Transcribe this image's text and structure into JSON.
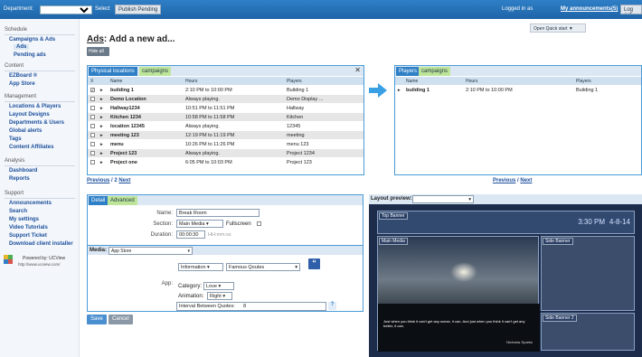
{
  "topbar": {
    "department_label": "Department:",
    "select_label": "Select",
    "publish_label": "Publish Pending",
    "logged_in": "Logged in as",
    "announcements": "My announcements(5)",
    "logout": "Log out"
  },
  "sidebar": {
    "schedule": "Schedule",
    "campaigns_ads": "Campaigns & Ads",
    "ads": "Ads",
    "pending_ads": "Pending ads",
    "content": "Content",
    "ezboard": "EZBoard ®",
    "app_store": "App Store",
    "management": "Management",
    "locations_players": "Locations & Players",
    "layout_designs": "Layout Designs",
    "departments_users": "Departments & Users",
    "global_alerts": "Global alerts",
    "tags": "Tags",
    "content_affiliates": "Content Affiliates",
    "analysis": "Analysis",
    "dashboard": "Dashboard",
    "reports": "Reports",
    "support": "Support",
    "announcements": "Announcements",
    "search": "Search",
    "my_settings": "My settings",
    "video_tutorials": "Video Tutorials",
    "support_ticket": "Support Ticket",
    "download_installer": "Download client installer",
    "powered_by": "Powered by: UCView",
    "powered_url": "http://www.ucview.com/"
  },
  "main": {
    "title_prefix": "Ads",
    "title_rest": ": Add a new ad...",
    "hide_all": "Hide all",
    "quick_start": "Open Quick start ▼"
  },
  "locations": {
    "tab_physical": "Physical locations",
    "tab_campaigns": "campaigns",
    "close": "✕",
    "col_x": "X",
    "col_name": "Name",
    "col_hours": "Hours",
    "col_players": "Players",
    "rows": [
      {
        "name": "building 1",
        "hours": "2:10 PM to 10:00 PM",
        "players": "Building 1",
        "checked": "✓"
      },
      {
        "name": "Demo Location",
        "hours": "Always playing.",
        "players": "Demo Display ...",
        "checked": ""
      },
      {
        "name": "Hallway1234",
        "hours": "10:51 PM to 11:51 PM",
        "players": "Hallway",
        "checked": ""
      },
      {
        "name": "Kitchen 1234",
        "hours": "10:58 PM to 11:58 PM",
        "players": "Kitchen",
        "checked": ""
      },
      {
        "name": "location 12345",
        "hours": "Always playing.",
        "players": "12345",
        "checked": ""
      },
      {
        "name": "meeting 123",
        "hours": "12:19 PM to 11:19 PM",
        "players": "meeting",
        "checked": ""
      },
      {
        "name": "menu",
        "hours": "10:26 PM to 11:26 PM",
        "players": "menu 123",
        "checked": ""
      },
      {
        "name": "Project 123",
        "hours": "Always playing.",
        "players": "Project 1234",
        "checked": ""
      },
      {
        "name": "Project one",
        "hours": "6:05 PM to 10:03 PM",
        "players": "Project 123",
        "checked": ""
      }
    ],
    "pager_prev": "Previous",
    "pager_mid": " / 2 ",
    "pager_next": "Next"
  },
  "selected": {
    "tab_players": "Players",
    "tab_campaigns": "campaigns",
    "col_name": "Name",
    "col_hours": "Hours",
    "col_players": "Players",
    "rows": [
      {
        "name": "building 1",
        "hours": "2:10 PM to 10:00 PM",
        "players": "Building 1"
      }
    ],
    "pager_prev": "Previous",
    "pager_mid": " / ",
    "pager_next": "Next"
  },
  "detail": {
    "tab_detail": "Detail",
    "tab_advanced": "Advanced",
    "name_label": "Name:",
    "name_value": "Break Room",
    "section_label": "Section:",
    "section_value": "Main Media",
    "fullscreen_label": "Fullscreen",
    "duration_label": "Duration:",
    "duration_value": "00:00:30",
    "duration_hint": "HH:mm:ss",
    "media_label": "Media:",
    "media_value": "App Store",
    "app_label": "App:",
    "app_type": "Information",
    "app_name": "Famous Qoutes",
    "category_label": "Category:",
    "category_value": "Love",
    "animation_label": "Animation:",
    "animation_value": "Right",
    "interval_label": "Interval Between Quotes:",
    "interval_value": "8",
    "help": "?",
    "save": "Save",
    "cancel": "Cancel"
  },
  "preview": {
    "label": "Layout preview:",
    "top_banner": "Top Banner",
    "time": "3:30 PM",
    "date": "4-8-14",
    "main_media": "Main Media",
    "side_banner": "Side Banner",
    "side_banner_2": "Side Banner 2",
    "quote": "Just when you think it can't get any worse, it can. And just when you think it can't get any better, it can.",
    "author": "Nicholas Sparks"
  },
  "colors": {
    "accent": "#2f7fc6",
    "panel_border": "#4a9bd8",
    "tab_green": "#bde59a",
    "preview_bg": "#1c2c4a"
  }
}
